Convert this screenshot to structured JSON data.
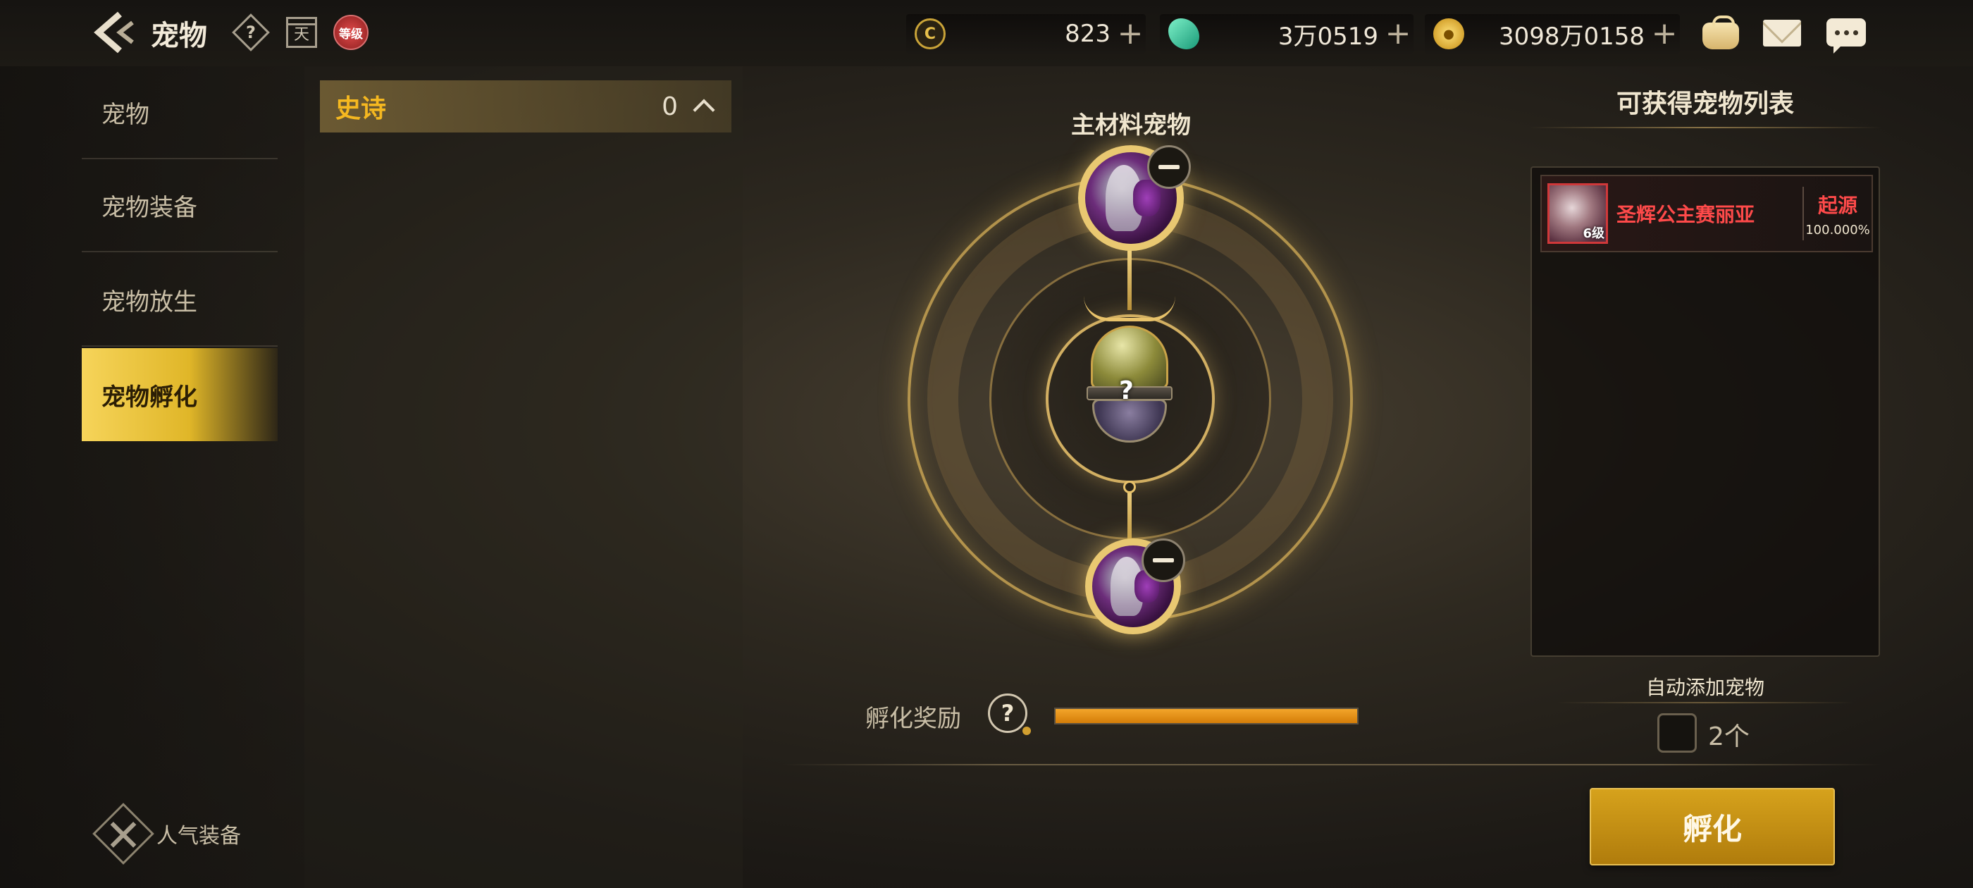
{
  "header": {
    "title": "宠物",
    "help_icon_text": "?",
    "calendar_icon_text": "天",
    "level_icon_text": "等级"
  },
  "currencies": [
    {
      "icon": "crystal-c-icon",
      "value": "823"
    },
    {
      "icon": "green-gem-icon",
      "value": "3万0519"
    },
    {
      "icon": "gold-coin-icon",
      "value": "3098万0158"
    }
  ],
  "top_right_icons": [
    "bag-icon",
    "mail-icon",
    "chat-icon"
  ],
  "sidebar": {
    "items": [
      {
        "label": "宠物",
        "active": false
      },
      {
        "label": "宠物装备",
        "active": false
      },
      {
        "label": "宠物放生",
        "active": false
      },
      {
        "label": "宠物孵化",
        "active": true
      }
    ],
    "bottom_label": "人气装备"
  },
  "list": {
    "grade_name": "史诗",
    "grade_count": "0"
  },
  "hatch": {
    "main_material_label": "主材料宠物",
    "egg_mark": "?",
    "reward_label": "孵化奖励",
    "reward_help": "?",
    "reward_progress": 1.0,
    "hatch_button": "孵化"
  },
  "obtainable": {
    "title": "可获得宠物列表",
    "items": [
      {
        "name": "圣辉公主赛丽亚",
        "type": "起源",
        "rate": "100.000%",
        "rank": "6级"
      }
    ]
  },
  "auto_add": {
    "label": "自动添加宠物",
    "count": "2个",
    "checked": false
  },
  "colors": {
    "accent_gold": "#e0b628",
    "grade_epic": "#f5b820",
    "origin_red": "#ff4a4a",
    "progress_orange": "#f3a52a"
  }
}
